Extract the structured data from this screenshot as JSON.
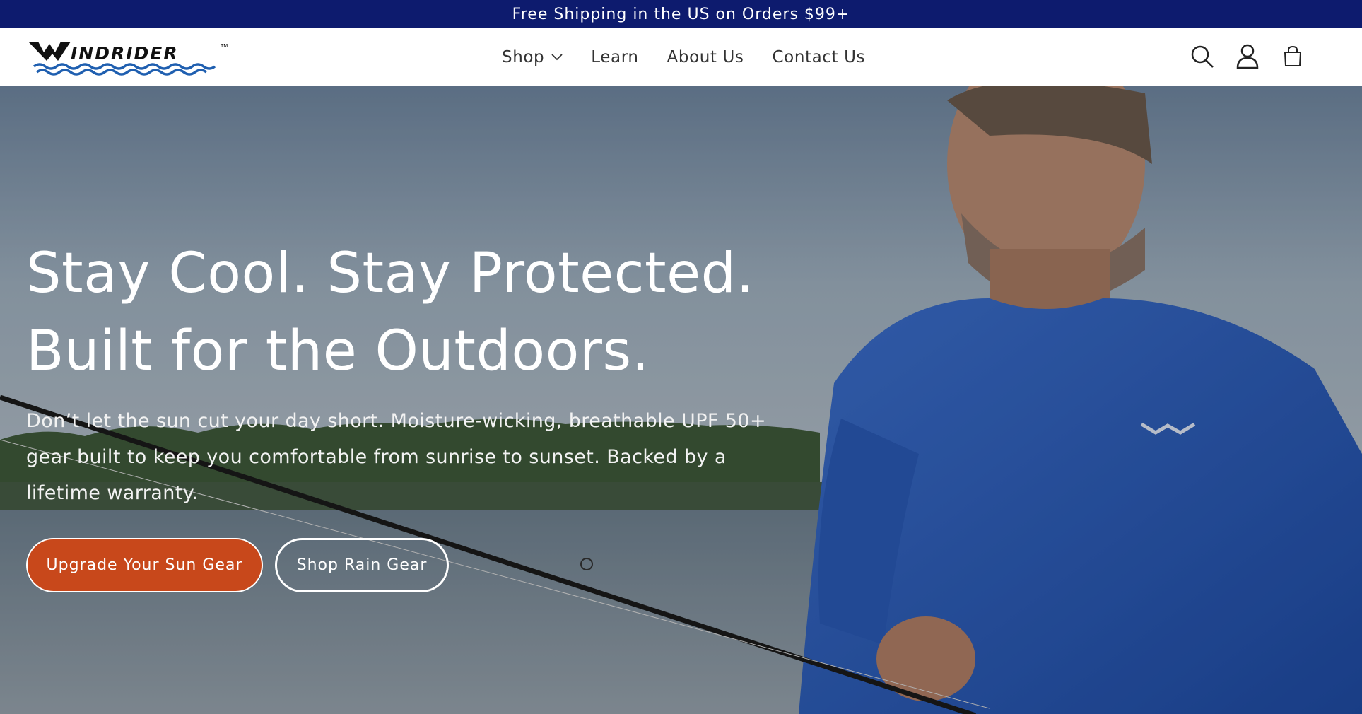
{
  "announcement": {
    "text": "Free Shipping in the US on Orders $99+"
  },
  "header": {
    "logo_text": "WindRider",
    "nav": [
      {
        "label": "Shop",
        "has_dropdown": true
      },
      {
        "label": "Learn",
        "has_dropdown": false
      },
      {
        "label": "About Us",
        "has_dropdown": false
      },
      {
        "label": "Contact Us",
        "has_dropdown": false
      }
    ],
    "icons": [
      "search-icon",
      "account-icon",
      "cart-icon"
    ]
  },
  "hero": {
    "title_line1": "Stay Cool. Stay Protected.",
    "title_line2": "Built for the Outdoors.",
    "subtitle": "Don’t let the sun cut your day short. Moisture-wicking, breathable UPF 50+ gear built to keep you comfortable from sunrise to sunset. Backed by a lifetime warranty.",
    "primary_button": "Upgrade Your Sun Gear",
    "secondary_button": "Shop Rain Gear"
  },
  "colors": {
    "announcement_bg": "#0d1b6e",
    "primary_button_bg": "#c8481b",
    "shirt_blue": "#2e5bb8",
    "logo_blue": "#1f5fb0"
  }
}
